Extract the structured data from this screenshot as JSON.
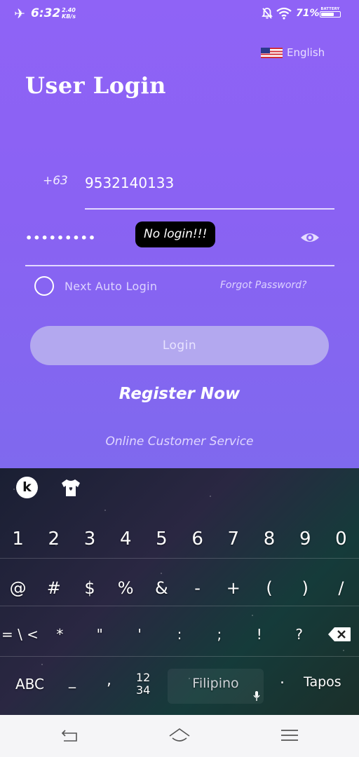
{
  "status_bar": {
    "time": "6:32",
    "net_speed_value": "2.40",
    "net_speed_unit": "KB/s",
    "battery_percent": "71%",
    "battery_label": "BATTERY",
    "battery_level": 0.71
  },
  "language": {
    "label": "English",
    "icon": "us-flag-icon"
  },
  "title": "User Login",
  "form": {
    "country_code": "+63",
    "phone_value": "9532140133",
    "password_value": "•••••••••"
  },
  "toast": {
    "text": "No login!!!"
  },
  "options": {
    "auto_login": "Next Auto Login",
    "forgot_password": "Forgot Password?"
  },
  "buttons": {
    "login": "Login",
    "register": "Register Now",
    "customer_service": "Online Customer Service"
  },
  "keyboard": {
    "logo": "k",
    "digits": [
      "1",
      "2",
      "3",
      "4",
      "5",
      "6",
      "7",
      "8",
      "9",
      "0"
    ],
    "symbols_row1": [
      "@",
      "#",
      "$",
      "%",
      "&",
      "-",
      "+",
      "(",
      ")",
      "/"
    ],
    "symbols_row2": [
      "= \\ <",
      "*",
      "\"",
      "'",
      ":",
      ";",
      "!",
      "?"
    ],
    "bottom": {
      "abc": "ABC",
      "underscore": "_",
      "comma": ",",
      "nums_top": "12",
      "nums_bottom": "34",
      "space": "Filipino",
      "period": ".",
      "enter": "Tapos"
    }
  },
  "colors": {
    "background_top": "#8f63f6",
    "background_bottom": "#7f69ee",
    "login_button": "#b3a8ef",
    "toast_bg": "#000000",
    "nav_bar": "#f5f5f7"
  }
}
